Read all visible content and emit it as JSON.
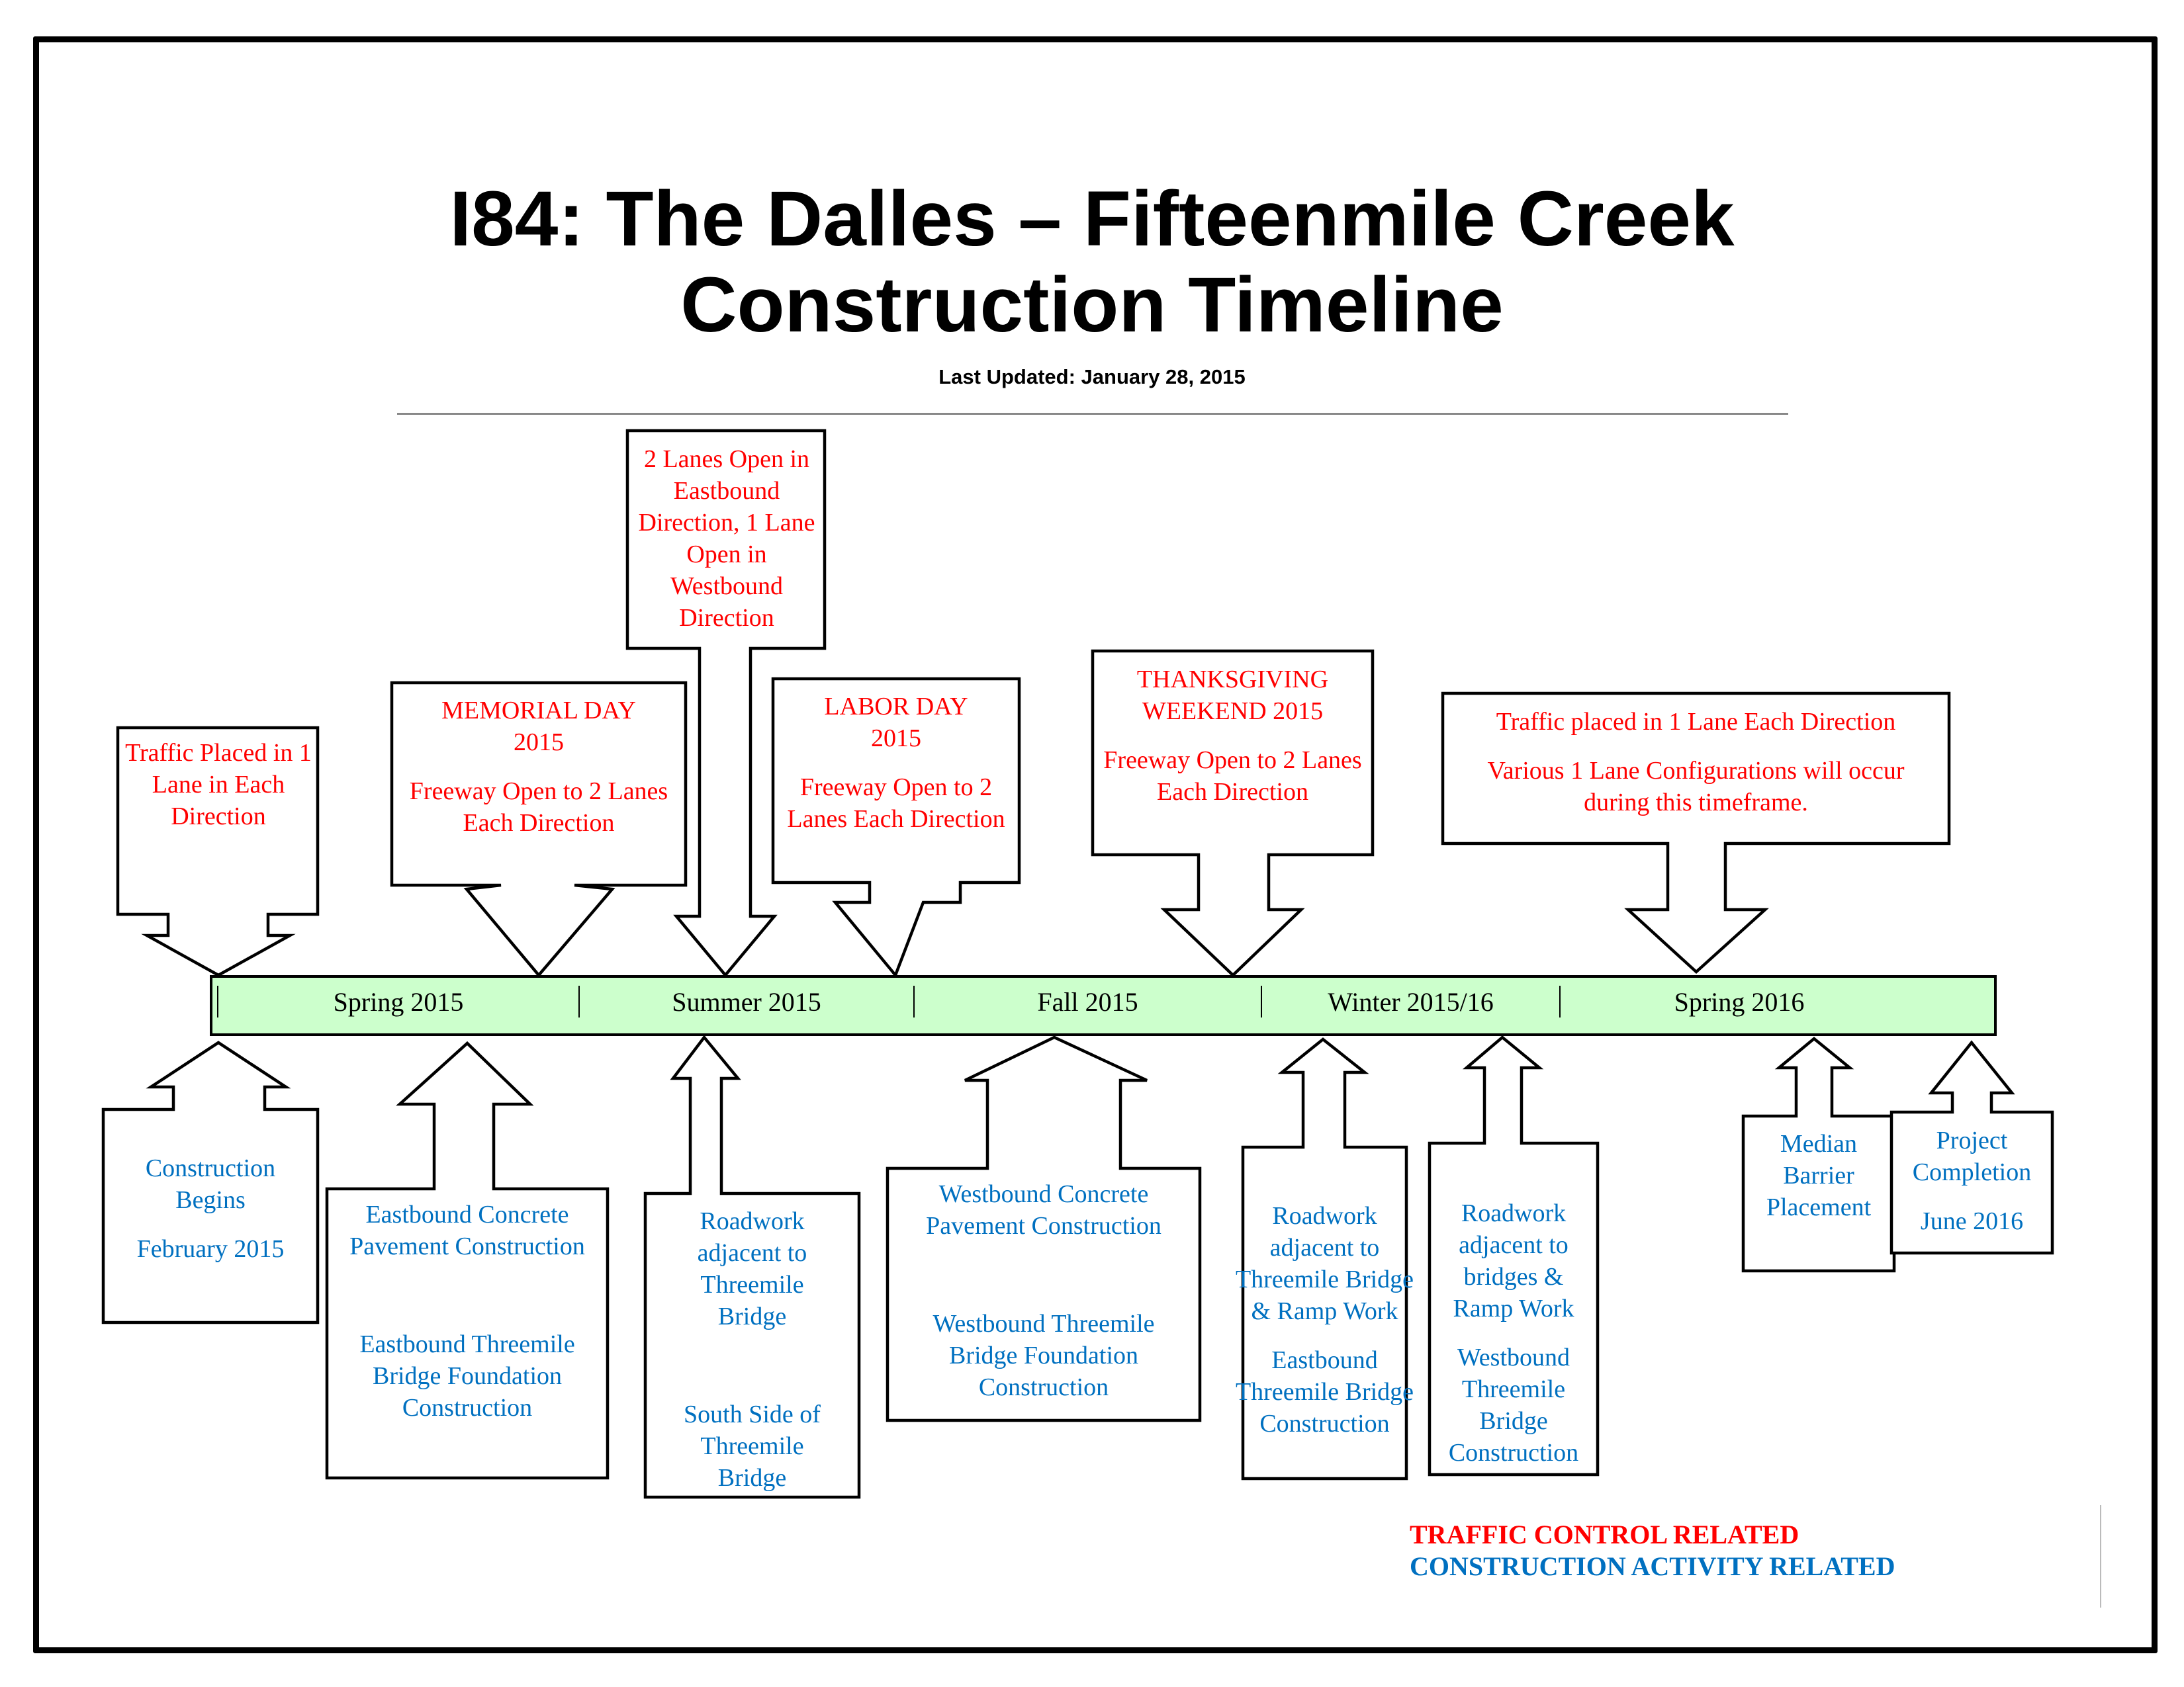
{
  "header": {
    "title_line1": "I84: The Dalles – Fifteenmile Creek",
    "title_line2": "Construction Timeline",
    "last_updated": "Last Updated: January 28, 2015"
  },
  "colors": {
    "traffic_control": "#ff0000",
    "construction_activity": "#0070c0",
    "timeline_bar": "#ccffcc"
  },
  "timeline": {
    "seasons": [
      "Spring 2015",
      "Summer 2015",
      "Fall 2015",
      "Winter 2015/16",
      "Spring 2016"
    ]
  },
  "traffic_events": [
    {
      "lines": [
        "Traffic Placed in 1 Lane in Each Direction"
      ]
    },
    {
      "lines": [
        "MEMORIAL DAY 2015",
        "Freeway Open to 2 Lanes Each Direction"
      ]
    },
    {
      "lines": [
        "2 Lanes Open in Eastbound Direction, 1 Lane Open in Westbound Direction"
      ]
    },
    {
      "lines": [
        "LABOR DAY 2015",
        "Freeway Open to 2 Lanes Each Direction"
      ]
    },
    {
      "lines": [
        "THANKSGIVING WEEKEND 2015",
        "Freeway Open to 2 Lanes Each Direction"
      ]
    },
    {
      "lines": [
        "Traffic placed in 1 Lane Each Direction",
        "Various 1 Lane Configurations will occur during this timeframe."
      ]
    }
  ],
  "construction_events": [
    {
      "lines": [
        "Construction Begins",
        "February 2015"
      ]
    },
    {
      "lines": [
        "Eastbound Concrete Pavement Construction",
        "Eastbound Threemile Bridge Foundation Construction"
      ]
    },
    {
      "lines": [
        "Roadwork adjacent to Threemile Bridge",
        "South Side of Threemile Bridge"
      ]
    },
    {
      "lines": [
        "Westbound Concrete Pavement Construction",
        "Westbound Threemile Bridge Foundation Construction"
      ]
    },
    {
      "lines": [
        "Roadwork adjacent to Threemile Bridge & Ramp Work",
        "Eastbound Threemile Bridge Construction"
      ]
    },
    {
      "lines": [
        "Roadwork adjacent to bridges & Ramp Work",
        "Westbound Threemile Bridge Construction"
      ]
    },
    {
      "lines": [
        "Median Barrier Placement"
      ]
    },
    {
      "lines": [
        "Project Completion",
        "June 2016"
      ]
    }
  ],
  "legend": {
    "traffic_label": "TRAFFIC CONTROL RELATED",
    "construction_label": "CONSTRUCTION ACTIVITY RELATED"
  }
}
